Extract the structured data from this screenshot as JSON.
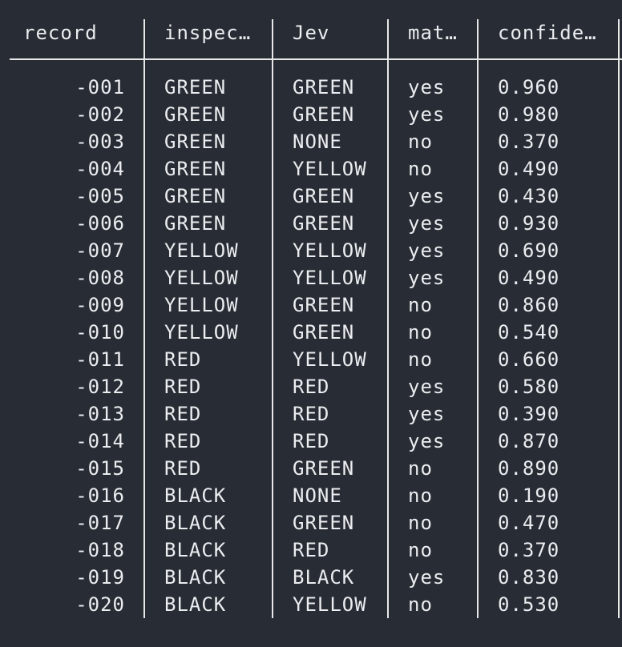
{
  "table": {
    "headers": [
      "record",
      "inspec…",
      "Jev",
      "mat…",
      "confide…"
    ],
    "rows": [
      [
        "-001",
        "GREEN",
        "GREEN",
        "yes",
        "0.960"
      ],
      [
        "-002",
        "GREEN",
        "GREEN",
        "yes",
        "0.980"
      ],
      [
        "-003",
        "GREEN",
        "NONE",
        "no",
        "0.370"
      ],
      [
        "-004",
        "GREEN",
        "YELLOW",
        "no",
        "0.490"
      ],
      [
        "-005",
        "GREEN",
        "GREEN",
        "yes",
        "0.430"
      ],
      [
        "-006",
        "GREEN",
        "GREEN",
        "yes",
        "0.930"
      ],
      [
        "-007",
        "YELLOW",
        "YELLOW",
        "yes",
        "0.690"
      ],
      [
        "-008",
        "YELLOW",
        "YELLOW",
        "yes",
        "0.490"
      ],
      [
        "-009",
        "YELLOW",
        "GREEN",
        "no",
        "0.860"
      ],
      [
        "-010",
        "YELLOW",
        "GREEN",
        "no",
        "0.540"
      ],
      [
        "-011",
        "RED",
        "YELLOW",
        "no",
        "0.660"
      ],
      [
        "-012",
        "RED",
        "RED",
        "yes",
        "0.580"
      ],
      [
        "-013",
        "RED",
        "RED",
        "yes",
        "0.390"
      ],
      [
        "-014",
        "RED",
        "RED",
        "yes",
        "0.870"
      ],
      [
        "-015",
        "RED",
        "GREEN",
        "no",
        "0.890"
      ],
      [
        "-016",
        "BLACK",
        "NONE",
        "no",
        "0.190"
      ],
      [
        "-017",
        "BLACK",
        "GREEN",
        "no",
        "0.470"
      ],
      [
        "-018",
        "BLACK",
        "RED",
        "no",
        "0.370"
      ],
      [
        "-019",
        "BLACK",
        "BLACK",
        "yes",
        "0.830"
      ],
      [
        "-020",
        "BLACK",
        "YELLOW",
        "no",
        "0.530"
      ]
    ]
  },
  "colors": {
    "background": "#282c34",
    "text": "#ebedf0",
    "rule": "#e8e8e8"
  }
}
